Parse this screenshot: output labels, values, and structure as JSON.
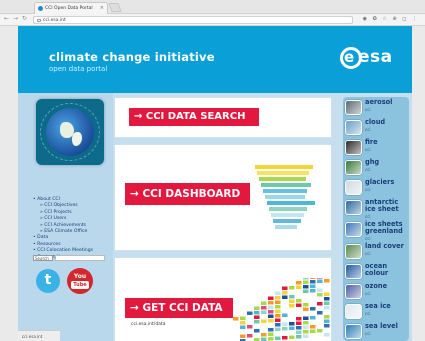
{
  "browser": {
    "tab_title": "CCI Open Data Portal",
    "tab_close": "×",
    "address": "cci.esa.int",
    "nav_icons": [
      "←",
      "→",
      "↻"
    ],
    "toolbar_icons": "◉ ✪ ☆ ⊕ ◻ ⋮"
  },
  "header": {
    "title": "climate change initiative",
    "subtitle": "open data portal",
    "logo_text": "esa",
    "logo_letter": "e"
  },
  "menu": {
    "items": [
      {
        "label": "• About CCI",
        "sub": false
      },
      {
        "label": "» CCI Objectives",
        "sub": true
      },
      {
        "label": "» CCI Projects",
        "sub": true
      },
      {
        "label": "» CCI Users",
        "sub": true
      },
      {
        "label": "» CCI Achievements",
        "sub": true
      },
      {
        "label": "» ESA Climate Office",
        "sub": true
      },
      {
        "label": "• Data",
        "sub": false
      },
      {
        "label": "• Resources",
        "sub": false
      },
      {
        "label": "• CCI Colocation Meetings",
        "sub": false
      },
      {
        "label": "• Contact Us",
        "sub": false
      }
    ],
    "search_label": "Search"
  },
  "social": {
    "twitter_glyph": "t",
    "youtube_top": "You",
    "youtube_bottom": "Tube"
  },
  "panels": {
    "search": "→ CCI DATA SEARCH",
    "dashboard": "→ CCI DASHBOARD",
    "getdata": "→ GET CCI DATA",
    "getdata_url": "cci.esa.int/data"
  },
  "status_bar": "cci.esa.int",
  "ecvs": [
    {
      "name": "aerosol",
      "sub": "cci",
      "color": "#5a6b74"
    },
    {
      "name": "cloud",
      "sub": "cci",
      "color": "#6aa0c8"
    },
    {
      "name": "fire",
      "sub": "cci",
      "color": "#2a2a2a"
    },
    {
      "name": "ghg",
      "sub": "cci",
      "color": "#3b7a3a"
    },
    {
      "name": "glaciers",
      "sub": "cci",
      "color": "#cfd9e4"
    },
    {
      "name": "antarctic ice sheet",
      "sub": "cci",
      "color": "#2c6aa0"
    },
    {
      "name": "ice sheets greenland",
      "sub": "cci",
      "color": "#3f7ab5"
    },
    {
      "name": "land cover",
      "sub": "cci",
      "color": "#5a8a4a"
    },
    {
      "name": "ocean colour",
      "sub": "cci",
      "color": "#1f5aa0"
    },
    {
      "name": "ozone",
      "sub": "cci",
      "color": "#4f5fa8"
    },
    {
      "name": "sea ice",
      "sub": "cci",
      "color": "#dfe9f2"
    },
    {
      "name": "sea level",
      "sub": "cci",
      "color": "#2b7fb8"
    }
  ]
}
